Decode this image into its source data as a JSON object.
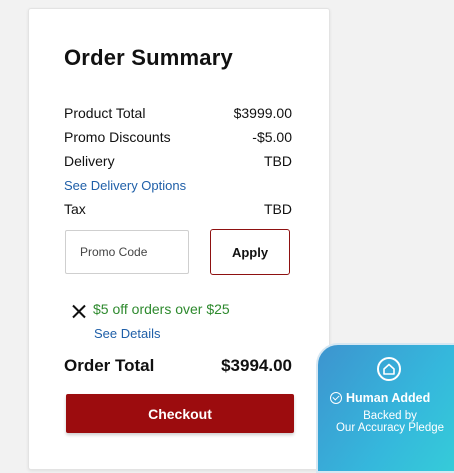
{
  "summary": {
    "title": "Order Summary",
    "lines": [
      {
        "label": "Product Total",
        "value": "$3999.00"
      },
      {
        "label": "Promo Discounts",
        "value": "-$5.00"
      },
      {
        "label": "Delivery",
        "value": "TBD"
      },
      {
        "label": "Tax",
        "value": "TBD"
      }
    ],
    "delivery_link": "See Delivery Options"
  },
  "promo": {
    "placeholder": "Promo Code",
    "apply_label": "Apply",
    "applied_text": "$5 off orders over $25",
    "details_link": "See Details"
  },
  "total": {
    "label": "Order Total",
    "value": "$3994.00"
  },
  "checkout_label": "Checkout",
  "badge": {
    "main_text": "Human Added",
    "sub_line1": "Backed by",
    "sub_line2": "Our Accuracy Pledge",
    "icon": "house-icon"
  },
  "colors": {
    "brand_red": "#9c0c0e",
    "link_blue": "#1f5fa8",
    "promo_green": "#2e8a2e",
    "badge_teal": "#35b7dc"
  }
}
